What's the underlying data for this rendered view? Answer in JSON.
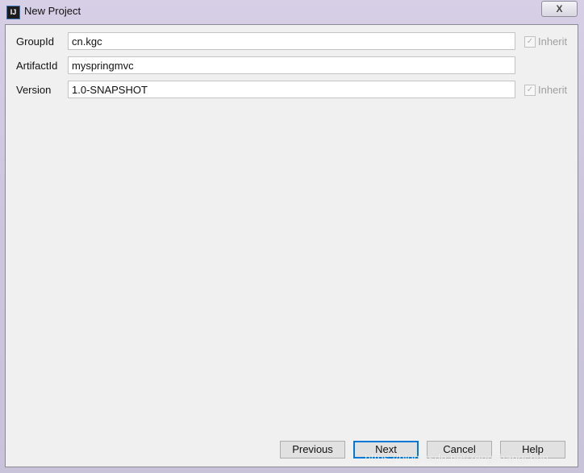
{
  "window": {
    "title": "New Project",
    "app_icon_text": "IJ",
    "close_glyph": "X"
  },
  "form": {
    "fields": [
      {
        "label": "GroupId",
        "value": "cn.kgc",
        "inherit_label": "Inherit",
        "inherit_checked": true
      },
      {
        "label": "ArtifactId",
        "value": "myspringmvc"
      },
      {
        "label": "Version",
        "value": "1.0-SNAPSHOT",
        "inherit_label": "Inherit",
        "inherit_checked": true
      }
    ]
  },
  "buttons": {
    "previous": "Previous",
    "next": "Next",
    "cancel": "Cancel",
    "help": "Help"
  },
  "watermark": "https://blog.csdn.net/zengshangchun"
}
